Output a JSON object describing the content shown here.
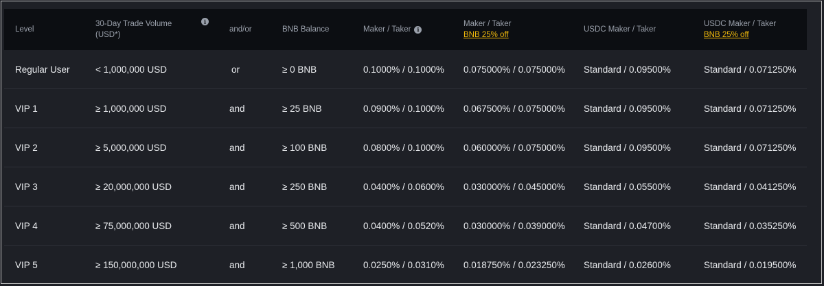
{
  "headers": {
    "level": "Level",
    "volume_line1": "30-Day Trade Volume",
    "volume_line2": "(USD*)",
    "andor": "and/or",
    "bnb_balance": "BNB Balance",
    "maker_taker": "Maker / Taker",
    "maker_taker_bnb_line1": "Maker / Taker",
    "maker_taker_bnb_discount": "BNB 25% off",
    "usdc_maker_taker": "USDC Maker / Taker",
    "usdc_maker_taker_bnb_line1": "USDC Maker / Taker",
    "usdc_maker_taker_bnb_discount": "BNB 25% off"
  },
  "icons": {
    "volume_info": "info-icon",
    "maker_taker_info": "info-icon"
  },
  "colors": {
    "background": "#1e2026",
    "header_background": "#0c0e12",
    "discount_link": "#f0b90b"
  },
  "rows": [
    {
      "level": "Regular User",
      "volume": "< 1,000,000 USD",
      "andor": "or",
      "bnb": "≥ 0 BNB",
      "mt": "0.1000% / 0.1000%",
      "mt_bnb": "0.075000% / 0.075000%",
      "usdc": "Standard / 0.09500%",
      "usdc_bnb": "Standard / 0.071250%"
    },
    {
      "level": "VIP 1",
      "volume": "≥ 1,000,000 USD",
      "andor": "and",
      "bnb": "≥ 25 BNB",
      "mt": "0.0900% / 0.1000%",
      "mt_bnb": "0.067500% / 0.075000%",
      "usdc": "Standard / 0.09500%",
      "usdc_bnb": "Standard / 0.071250%"
    },
    {
      "level": "VIP 2",
      "volume": "≥ 5,000,000 USD",
      "andor": "and",
      "bnb": "≥ 100 BNB",
      "mt": "0.0800% / 0.1000%",
      "mt_bnb": "0.060000% / 0.075000%",
      "usdc": "Standard / 0.09500%",
      "usdc_bnb": "Standard / 0.071250%"
    },
    {
      "level": "VIP 3",
      "volume": "≥ 20,000,000 USD",
      "andor": "and",
      "bnb": "≥ 250 BNB",
      "mt": "0.0400% / 0.0600%",
      "mt_bnb": "0.030000% / 0.045000%",
      "usdc": "Standard / 0.05500%",
      "usdc_bnb": "Standard / 0.041250%"
    },
    {
      "level": "VIP 4",
      "volume": "≥ 75,000,000 USD",
      "andor": "and",
      "bnb": "≥ 500 BNB",
      "mt": "0.0400% / 0.0520%",
      "mt_bnb": "0.030000% / 0.039000%",
      "usdc": "Standard / 0.04700%",
      "usdc_bnb": "Standard / 0.035250%"
    },
    {
      "level": "VIP 5",
      "volume": "≥ 150,000,000 USD",
      "andor": "and",
      "bnb": "≥ 1,000 BNB",
      "mt": "0.0250% / 0.0310%",
      "mt_bnb": "0.018750% / 0.023250%",
      "usdc": "Standard / 0.02600%",
      "usdc_bnb": "Standard / 0.019500%"
    }
  ]
}
